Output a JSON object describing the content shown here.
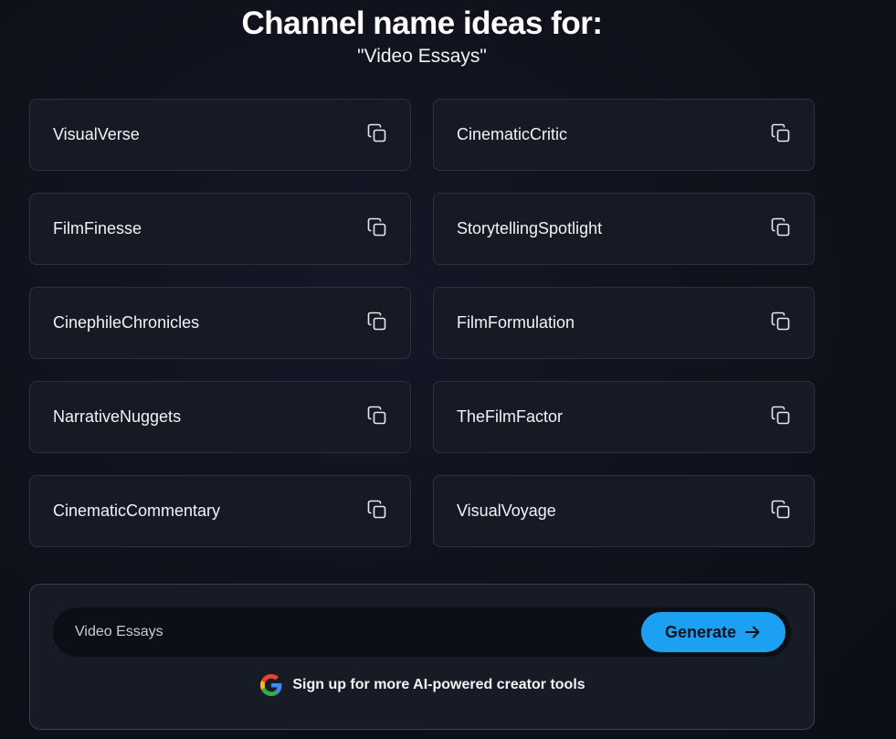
{
  "header": {
    "title": "Channel name ideas for:",
    "subtitle": "\"Video Essays\""
  },
  "ideas": [
    "VisualVerse",
    "CinematicCritic",
    "FilmFinesse",
    "StorytellingSpotlight",
    "CinephileChronicles",
    "FilmFormulation",
    "NarrativeNuggets",
    "TheFilmFactor",
    "CinematicCommentary",
    "VisualVoyage"
  ],
  "icons": {
    "copy": "copy-icon",
    "arrow": "arrow-right-icon",
    "google": "google-icon"
  },
  "form": {
    "input_value": "Video Essays",
    "generate_label": "Generate",
    "signup_label": "Sign up for more AI-powered creator tools"
  },
  "colors": {
    "accent": "#1ca0f2",
    "card_bg": "#151a24",
    "card_border": "#2b3140"
  }
}
